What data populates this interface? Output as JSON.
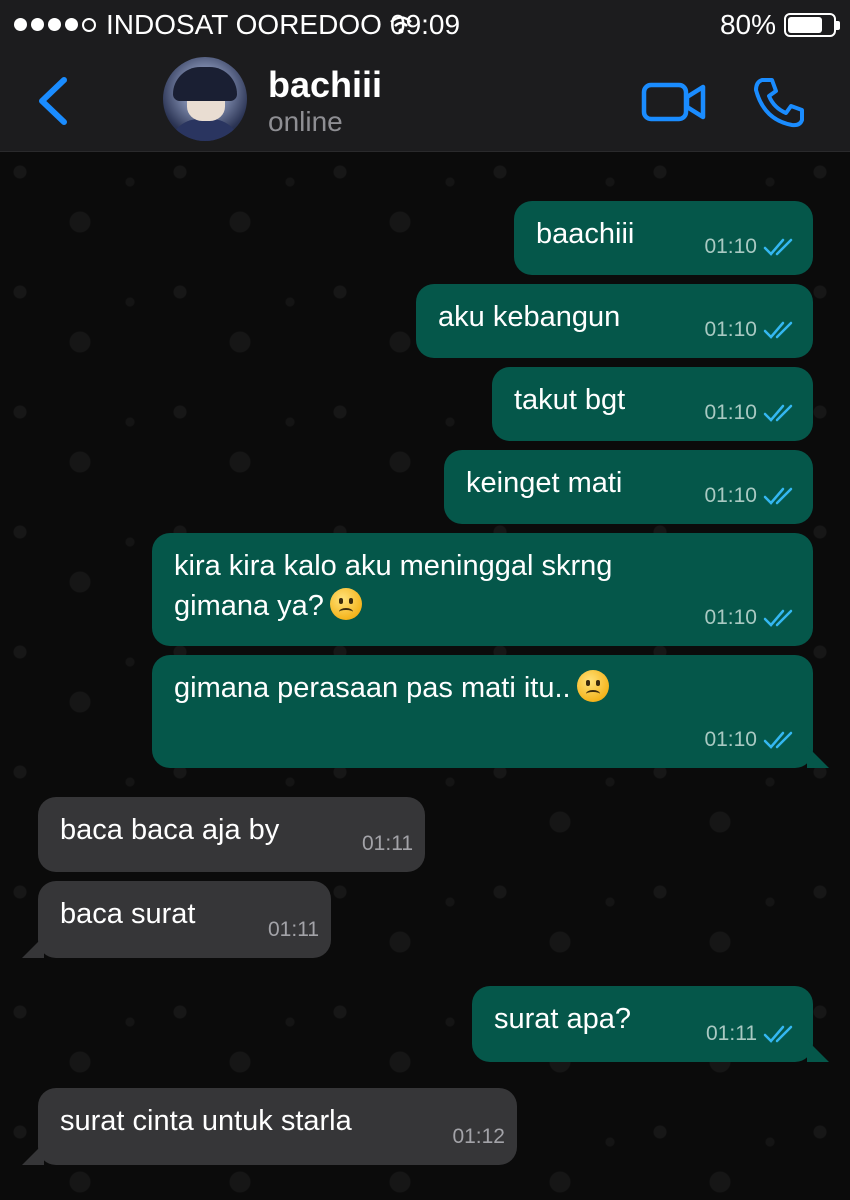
{
  "status_bar": {
    "carrier": "INDOSAT OOREDOO",
    "time": "09:09",
    "battery": "80%",
    "battery_level": 0.8,
    "signal_bars": 4,
    "icons": [
      "signal-icon",
      "wifi-icon",
      "battery-icon"
    ]
  },
  "header": {
    "name": "bachiii",
    "status": "online",
    "icons": [
      "chevron-left-icon",
      "video-icon",
      "phone-icon"
    ],
    "accent_color": "#1a8cff"
  },
  "messages": [
    {
      "direction": "out",
      "text": "baachiii",
      "time": "01:10",
      "read": true
    },
    {
      "direction": "out",
      "text": "aku kebangun",
      "time": "01:10",
      "read": true
    },
    {
      "direction": "out",
      "text": "takut bgt",
      "time": "01:10",
      "read": true
    },
    {
      "direction": "out",
      "text": "keinget mati",
      "time": "01:10",
      "read": true
    },
    {
      "direction": "out",
      "line1": "kira kira kalo aku meninggal skrng",
      "line2": "gimana ya?",
      "emoji": "confused-face-emoji",
      "time": "01:10",
      "read": true
    },
    {
      "direction": "out",
      "text": "gimana perasaan pas mati itu..",
      "emoji": "frowning-face-emoji",
      "time": "01:10",
      "read": true
    },
    {
      "direction": "in",
      "text": "baca baca aja by",
      "time": "01:11"
    },
    {
      "direction": "in",
      "text": "baca surat",
      "time": "01:11"
    },
    {
      "direction": "out",
      "text": "surat apa?",
      "time": "01:11",
      "read": true
    },
    {
      "direction": "in",
      "text": "surat cinta untuk starla",
      "time": "01:12"
    }
  ],
  "colors": {
    "outgoing_bubble": "#05574a",
    "incoming_bubble": "#363638",
    "read_ticks": "#34b7f1",
    "background": "#0b0b0b"
  }
}
